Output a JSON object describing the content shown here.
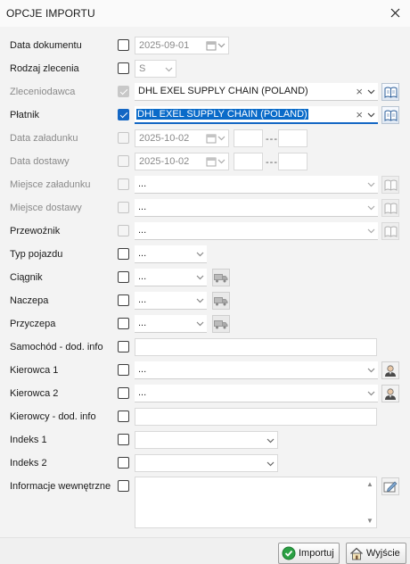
{
  "window": {
    "title": "OPCJE IMPORTU"
  },
  "rows": {
    "data_dokumentu": {
      "label": "Data dokumentu",
      "value": "2025-09-01"
    },
    "rodzaj_zlecenia": {
      "label": "Rodzaj zlecenia",
      "value": "S"
    },
    "zleceniodawca": {
      "label": "Zleceniodawca",
      "value": "DHL EXEL SUPPLY CHAIN (POLAND)"
    },
    "platnik": {
      "label": "Płatnik",
      "value": "DHL EXEL SUPPLY CHAIN (POLAND)"
    },
    "data_zaladunku": {
      "label": "Data załadunku",
      "value": "2025-10-02",
      "range_sep": "---"
    },
    "data_dostawy": {
      "label": "Data dostawy",
      "value": "2025-10-02",
      "range_sep": "---"
    },
    "miejsce_zaladunku": {
      "label": "Miejsce załadunku",
      "value": "..."
    },
    "miejsce_dostawy": {
      "label": "Miejsce dostawy",
      "value": "..."
    },
    "przewoznik": {
      "label": "Przewoźnik",
      "value": "..."
    },
    "typ_pojazdu": {
      "label": "Typ pojazdu",
      "value": "..."
    },
    "ciagnik": {
      "label": "Ciągnik",
      "value": "..."
    },
    "naczepa": {
      "label": "Naczepa",
      "value": "..."
    },
    "przyczepa": {
      "label": "Przyczepa",
      "value": "..."
    },
    "samochod_info": {
      "label": "Samochód - dod. info",
      "value": ""
    },
    "kierowca1": {
      "label": "Kierowca 1",
      "value": "..."
    },
    "kierowca2": {
      "label": "Kierowca 2",
      "value": "..."
    },
    "kierowcy_info": {
      "label": "Kierowcy - dod. info",
      "value": ""
    },
    "indeks1": {
      "label": "Indeks 1",
      "value": ""
    },
    "indeks2": {
      "label": "Indeks 2",
      "value": ""
    },
    "informacje": {
      "label": "Informacje wewnętrzne",
      "value": ""
    }
  },
  "buttons": {
    "import_label": "Importuj",
    "exit_label": "Wyjście"
  },
  "colors": {
    "accent": "#1467c4",
    "selection": "#0a6bc9",
    "ok_green": "#2aa043"
  }
}
